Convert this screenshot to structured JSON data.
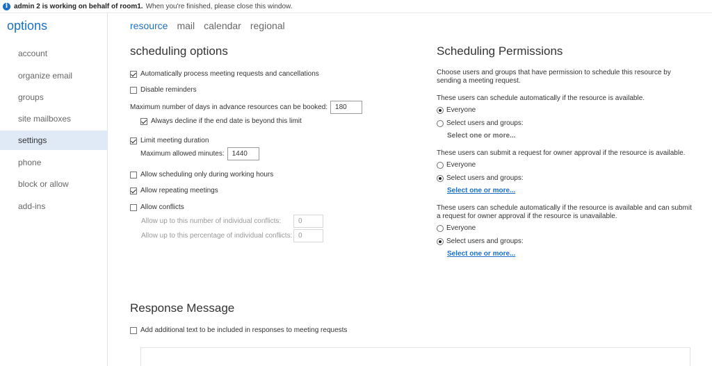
{
  "infobar": {
    "bold_text": "admin 2 is working on behalf of room1.",
    "text": "When you're finished, please close this window."
  },
  "nav": {
    "title": "options",
    "items": [
      {
        "label": "account",
        "active": false
      },
      {
        "label": "organize email",
        "active": false
      },
      {
        "label": "groups",
        "active": false
      },
      {
        "label": "site mailboxes",
        "active": false
      },
      {
        "label": "settings",
        "active": true
      },
      {
        "label": "phone",
        "active": false
      },
      {
        "label": "block or allow",
        "active": false
      },
      {
        "label": "add-ins",
        "active": false
      }
    ]
  },
  "tabs": [
    {
      "label": "resource",
      "active": true
    },
    {
      "label": "mail",
      "active": false
    },
    {
      "label": "calendar",
      "active": false
    },
    {
      "label": "regional",
      "active": false
    }
  ],
  "scheduling": {
    "title": "scheduling options",
    "auto_process": {
      "label": "Automatically process meeting requests and cancellations",
      "checked": true
    },
    "disable_reminders": {
      "label": "Disable reminders",
      "checked": false
    },
    "max_days_label": "Maximum number of days in advance resources can be booked:",
    "max_days_value": "180",
    "always_decline": {
      "label": "Always decline if the end date is beyond this limit",
      "checked": true
    },
    "limit_duration": {
      "label": "Limit meeting duration",
      "checked": true
    },
    "max_minutes_label": "Maximum allowed minutes:",
    "max_minutes_value": "1440",
    "working_hours": {
      "label": "Allow scheduling only during working hours",
      "checked": false
    },
    "repeating": {
      "label": "Allow repeating meetings",
      "checked": true
    },
    "conflicts": {
      "label": "Allow conflicts",
      "checked": false
    },
    "conflict_number_label": "Allow up to this number of individual conflicts:",
    "conflict_number_value": "0",
    "conflict_percent_label": "Allow up to this percentage of individual conflicts:",
    "conflict_percent_value": "0"
  },
  "permissions": {
    "title": "Scheduling Permissions",
    "intro": "Choose users and groups that have permission to schedule this resource by sending a meeting request.",
    "group1": {
      "desc": "These users can schedule automatically if the resource is available.",
      "everyone": "Everyone",
      "select": "Select users and groups:",
      "link": "Select one or more...",
      "selected": "everyone"
    },
    "group2": {
      "desc": "These users can submit a request for owner approval if the resource is available.",
      "everyone": "Everyone",
      "select": "Select users and groups:",
      "link": "Select one or more...",
      "selected": "select"
    },
    "group3": {
      "desc": "These users can schedule automatically if the resource is available and can submit a request for owner approval if the resource is unavailable.",
      "everyone": "Everyone",
      "select": "Select users and groups:",
      "link": "Select one or more...",
      "selected": "select"
    }
  },
  "response": {
    "title": "Response Message",
    "add_text": {
      "label": "Add additional text to be included in responses to meeting requests",
      "checked": false
    }
  }
}
